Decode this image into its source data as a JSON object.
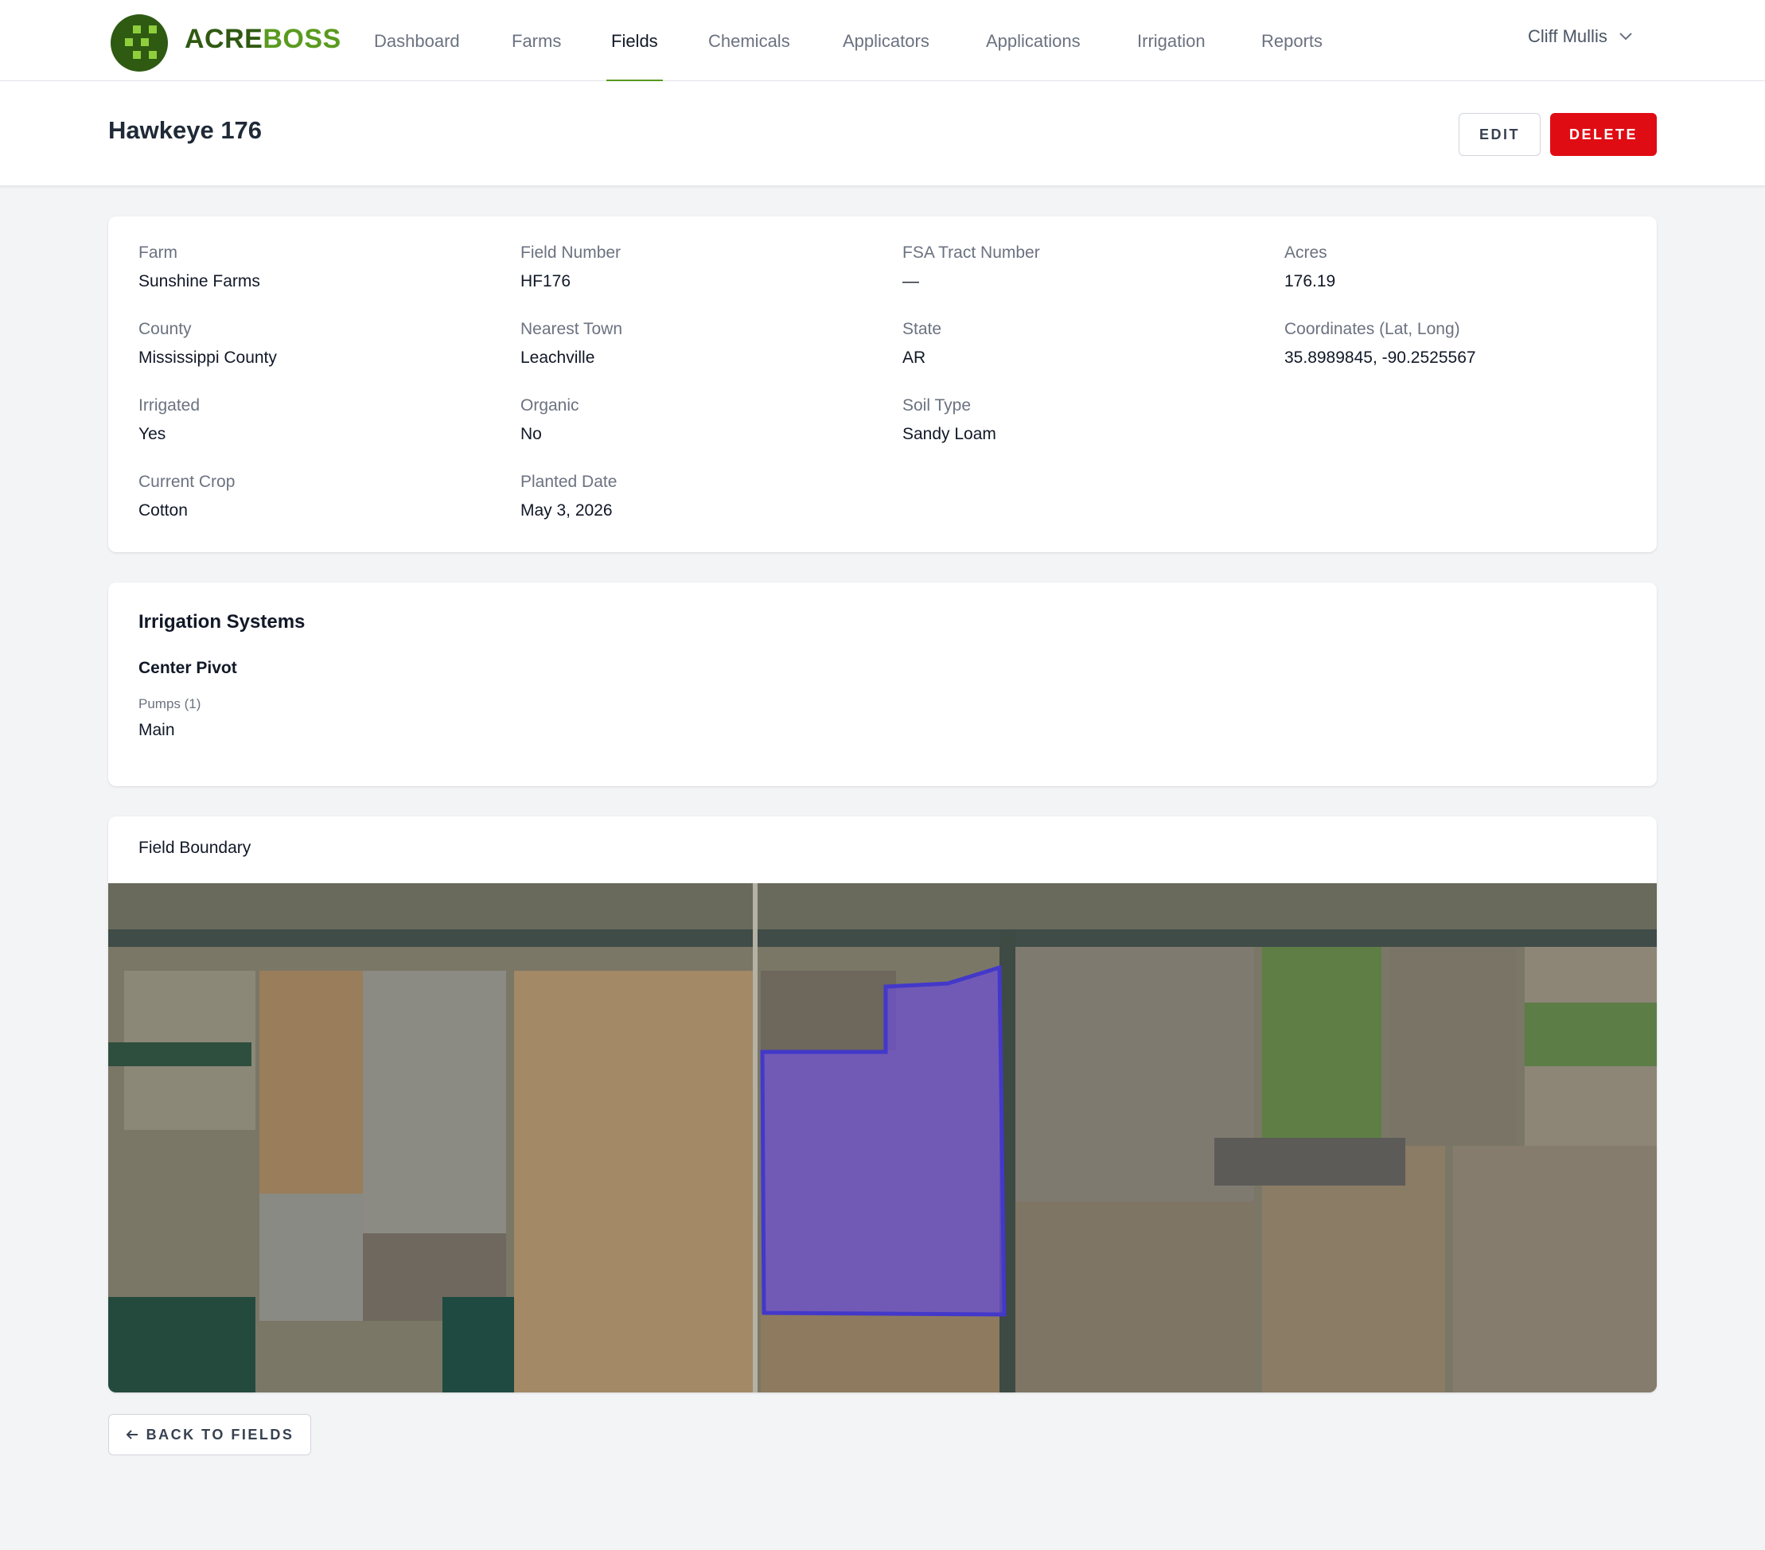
{
  "brand": {
    "part1": "ACRE",
    "part2": "BOSS"
  },
  "nav": {
    "items": [
      {
        "label": "Dashboard",
        "active": false
      },
      {
        "label": "Farms",
        "active": false
      },
      {
        "label": "Fields",
        "active": true
      },
      {
        "label": "Chemicals",
        "active": false
      },
      {
        "label": "Applicators",
        "active": false
      },
      {
        "label": "Applications",
        "active": false
      },
      {
        "label": "Irrigation",
        "active": false
      },
      {
        "label": "Reports",
        "active": false
      }
    ],
    "user": "Cliff Mullis"
  },
  "header": {
    "title": "Hawkeye 176",
    "edit_label": "EDIT",
    "delete_label": "DELETE"
  },
  "details": [
    {
      "label": "Farm",
      "value": "Sunshine Farms"
    },
    {
      "label": "Field Number",
      "value": "HF176"
    },
    {
      "label": "FSA Tract Number",
      "value": "—"
    },
    {
      "label": "Acres",
      "value": "176.19"
    },
    {
      "label": "County",
      "value": "Mississippi County"
    },
    {
      "label": "Nearest Town",
      "value": "Leachville"
    },
    {
      "label": "State",
      "value": "AR"
    },
    {
      "label": "Coordinates (Lat, Long)",
      "value": "35.8989845, -90.2525567"
    },
    {
      "label": "Irrigated",
      "value": "Yes"
    },
    {
      "label": "Organic",
      "value": "No"
    },
    {
      "label": "Soil Type",
      "value": "Sandy Loam"
    },
    {
      "label": "Current Crop",
      "value": "Cotton"
    },
    {
      "label": "Planted Date",
      "value": "May 3, 2026"
    }
  ],
  "irrigation": {
    "title": "Irrigation Systems",
    "system_name": "Center Pivot",
    "pumps_label": "Pumps (1)",
    "pump_name": "Main"
  },
  "boundary": {
    "title": "Field Boundary",
    "outline_color": "#4338ca",
    "fill_color": "#6d4fd8"
  },
  "back_label": "BACK TO FIELDS",
  "colors": {
    "brand_dark": "#2f5a12",
    "brand_light": "#5a9a1f",
    "danger": "#e00c13"
  }
}
